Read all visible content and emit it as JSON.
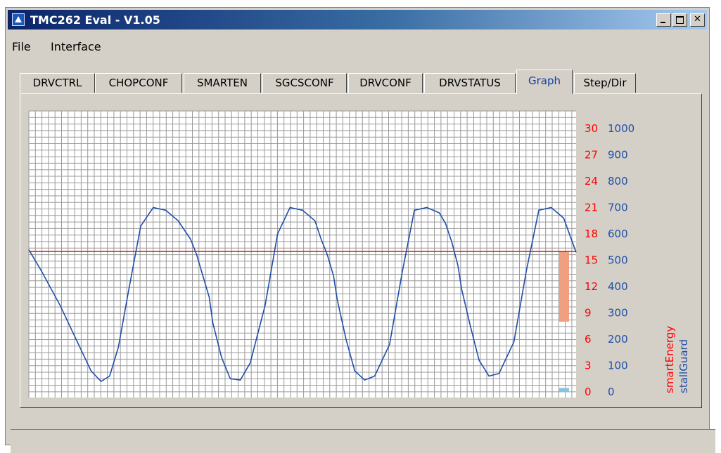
{
  "window": {
    "title": "TMC262 Eval - V1.05"
  },
  "menu": [
    "File",
    "Interface"
  ],
  "tabs": [
    {
      "label": "DRVCTRL",
      "active": false
    },
    {
      "label": "CHOPCONF",
      "active": false
    },
    {
      "label": "SMARTEN",
      "active": false
    },
    {
      "label": "SGCSCONF",
      "active": false
    },
    {
      "label": "DRVCONF",
      "active": false
    },
    {
      "label": "DRVSTATUS",
      "active": false
    },
    {
      "label": "Graph",
      "active": true
    },
    {
      "label": "Step/Dir",
      "active": false
    }
  ],
  "colors": {
    "smartEnergy": "#ff0000",
    "stallGuard": "#1f4fa8",
    "bar_orange": "#f0a080",
    "bar_blue": "#88c4e0",
    "grid": "#9a9a9a"
  },
  "chart_data": {
    "type": "line",
    "title": "",
    "grid": true,
    "x_range": [
      0,
      440
    ],
    "axes": {
      "smartEnergy": {
        "label": "smartEnergy",
        "ticks": [
          "0",
          "3",
          "6",
          "9",
          "12",
          "15",
          "18",
          "21",
          "24",
          "27",
          "30"
        ],
        "range": [
          0,
          30
        ]
      },
      "stallGuard": {
        "label": "stallGuard",
        "ticks": [
          "0",
          "100",
          "200",
          "300",
          "400",
          "500",
          "600",
          "700",
          "800",
          "900",
          "1000"
        ],
        "range": [
          0,
          1000
        ]
      }
    },
    "series": [
      {
        "name": "stallGuard",
        "axis": "stallGuard",
        "x": [
          0,
          10,
          25,
          40,
          50,
          58,
          65,
          72,
          80,
          90,
          100,
          110,
          120,
          130,
          135,
          140,
          145,
          148,
          155,
          162,
          170,
          178,
          190,
          200,
          210,
          220,
          230,
          235,
          240,
          245,
          248,
          255,
          262,
          270,
          278,
          290,
          300,
          310,
          320,
          330,
          335,
          340,
          345,
          348,
          355,
          362,
          370,
          378,
          390,
          400,
          410,
          420,
          430,
          440
        ],
        "y": [
          540,
          460,
          330,
          180,
          80,
          40,
          60,
          170,
          380,
          630,
          700,
          690,
          650,
          580,
          520,
          440,
          360,
          260,
          130,
          50,
          45,
          110,
          330,
          600,
          700,
          690,
          650,
          580,
          520,
          440,
          350,
          200,
          80,
          45,
          60,
          180,
          450,
          690,
          700,
          680,
          640,
          570,
          480,
          390,
          250,
          120,
          60,
          70,
          190,
          460,
          690,
          700,
          660,
          530
        ]
      },
      {
        "name": "smartEnergy",
        "axis": "smartEnergy",
        "x": [
          0,
          440
        ],
        "y": [
          16,
          16
        ]
      }
    ],
    "bars": [
      {
        "axis": "smartEnergy",
        "from": 8,
        "to": 16,
        "color": "orange"
      },
      {
        "axis": "stallGuard",
        "from": 0,
        "to": 15,
        "color": "blue"
      }
    ]
  }
}
